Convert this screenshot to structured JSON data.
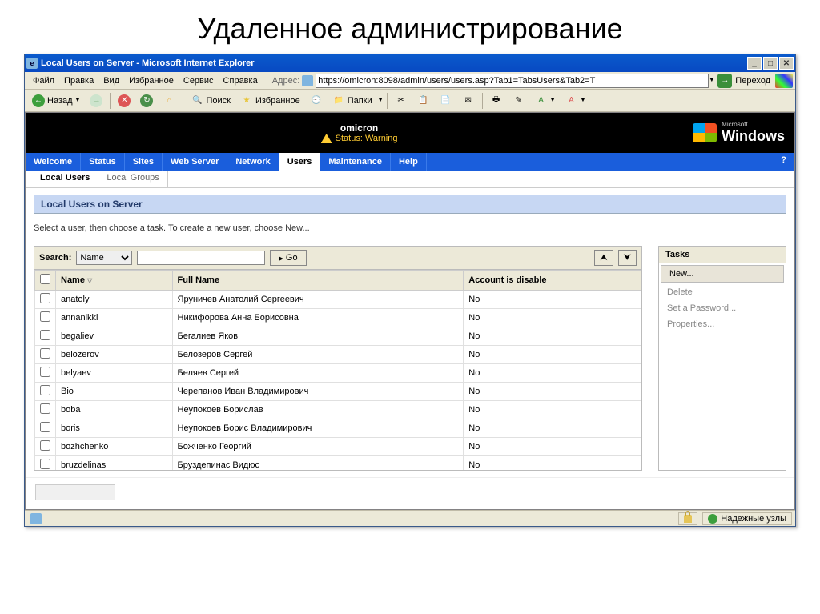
{
  "slide_title": "Удаленное администрирование",
  "window": {
    "title": "Local Users on Server - Microsoft Internet Explorer"
  },
  "menu": {
    "file": "Файл",
    "edit": "Правка",
    "view": "Вид",
    "favorites": "Избранное",
    "tools": "Сервис",
    "help": "Справка",
    "address_label": "Адрес:",
    "url": "https://omicron:8098/admin/users/users.asp?Tab1=TabsUsers&Tab2=T",
    "go": "Переход"
  },
  "toolbar": {
    "back": "Назад",
    "search": "Поиск",
    "favorites": "Избранное",
    "folders": "Папки"
  },
  "header": {
    "server": "omicron",
    "status_label": "Status: Warning",
    "brand_ms": "Microsoft",
    "brand_win": "Windows"
  },
  "tabs": {
    "items": [
      {
        "label": "Welcome",
        "active": false
      },
      {
        "label": "Status",
        "active": false
      },
      {
        "label": "Sites",
        "active": false
      },
      {
        "label": "Web Server",
        "active": false
      },
      {
        "label": "Network",
        "active": false
      },
      {
        "label": "Users",
        "active": true
      },
      {
        "label": "Maintenance",
        "active": false
      },
      {
        "label": "Help",
        "active": false
      }
    ],
    "help": "?"
  },
  "subtabs": {
    "items": [
      {
        "label": "Local Users",
        "active": true
      },
      {
        "label": "Local Groups",
        "active": false
      }
    ]
  },
  "panel": {
    "title": "Local Users on Server",
    "instruction": "Select a user, then choose a task. To create a new user, choose New..."
  },
  "search": {
    "label": "Search:",
    "field": "Name",
    "go": "Go"
  },
  "table": {
    "columns": {
      "name": "Name",
      "fullname": "Full Name",
      "disabled": "Account is disable"
    },
    "rows": [
      {
        "name": "anatoly",
        "fullname": "Яруничев Анатолий Сергеевич",
        "disabled": "No"
      },
      {
        "name": "annanikki",
        "fullname": "Никифорова Анна Борисовна",
        "disabled": "No"
      },
      {
        "name": "begaliev",
        "fullname": "Бегалиев Яков",
        "disabled": "No"
      },
      {
        "name": "belozerov",
        "fullname": "Белозеров Сергей",
        "disabled": "No"
      },
      {
        "name": "belyaev",
        "fullname": "Беляев Сергей",
        "disabled": "No"
      },
      {
        "name": "Bio",
        "fullname": "Черепанов Иван Владимирович",
        "disabled": "No"
      },
      {
        "name": "boba",
        "fullname": "Неупокоев Борислав",
        "disabled": "No"
      },
      {
        "name": "boris",
        "fullname": "Неупокоев Борис Владимирович",
        "disabled": "No"
      },
      {
        "name": "bozhchenko",
        "fullname": "Божченко Георгий",
        "disabled": "No"
      },
      {
        "name": "bruzdelinas",
        "fullname": "Бруздепинас Видюс",
        "disabled": "No"
      }
    ]
  },
  "tasks": {
    "header": "Tasks",
    "items": [
      {
        "label": "New...",
        "enabled": true
      },
      {
        "label": "Delete",
        "enabled": false
      },
      {
        "label": "Set a Password...",
        "enabled": false
      },
      {
        "label": "Properties...",
        "enabled": false
      }
    ]
  },
  "status": {
    "zone": "Надежные узлы"
  }
}
